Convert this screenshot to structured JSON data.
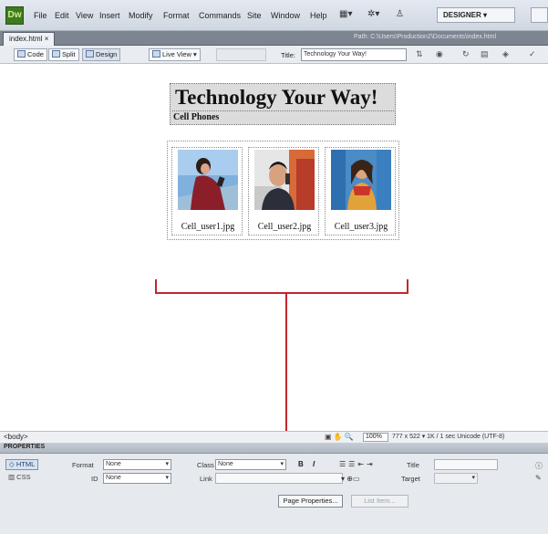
{
  "app": {
    "logo": "Dw",
    "menus": [
      "File",
      "Edit",
      "View",
      "Insert",
      "Modify",
      "Format",
      "Commands",
      "Site",
      "Window",
      "Help"
    ],
    "workspace": "DESIGNER"
  },
  "document": {
    "tab_label": "index.html",
    "tab_close": "×",
    "path": "Path: C:\\Users\\Production2\\Documents\\index.html"
  },
  "toolbar": {
    "code_label": "Code",
    "split_label": "Split",
    "design_label": "Design",
    "live_view_label": "Live View",
    "title_label": "Title:",
    "title_value": "Technology Your Way!"
  },
  "page": {
    "heading": "Technology Your Way!",
    "subheading": "Cell Phones",
    "phones": [
      {
        "caption": "Cell_user1.jpg"
      },
      {
        "caption": "Cell_user2.jpg"
      },
      {
        "caption": "Cell_user3.jpg"
      }
    ]
  },
  "status": {
    "tag": "<body>",
    "zoom": "100%",
    "info": "777 x 522 ▾  1K / 1 sec  Unicode (UTF-8)"
  },
  "properties": {
    "title": "PROPERTIES",
    "html_label": "HTML",
    "css_label": "CSS",
    "format_label": "Format",
    "format_value": "None",
    "id_label": "ID",
    "id_value": "None",
    "class_label": "Class",
    "class_value": "None",
    "link_label": "Link",
    "title_label": "Title",
    "target_label": "Target",
    "bold_label": "B",
    "italic_label": "I",
    "page_properties_label": "Page Properties...",
    "list_item_label": "List Item..."
  },
  "colors": {
    "callout": "#c1272d",
    "heading_background": "#dcdcdc"
  }
}
